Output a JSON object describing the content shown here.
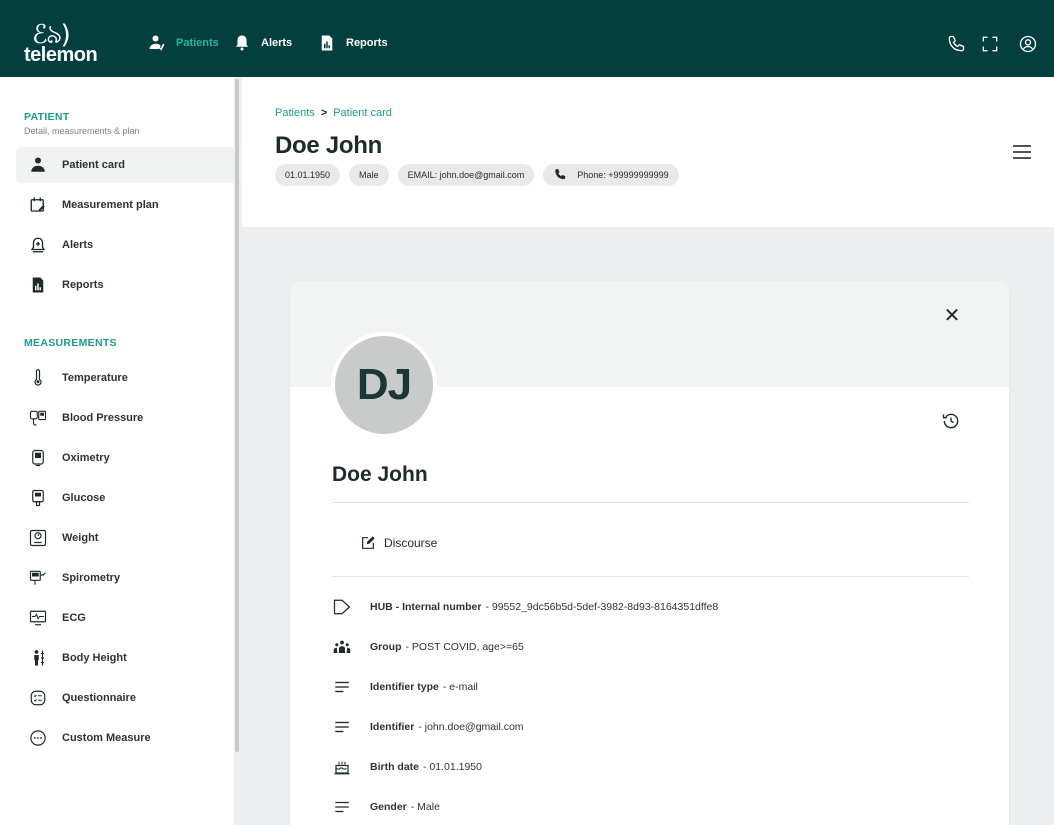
{
  "app": {
    "logo_text": "telemon"
  },
  "topnav": {
    "items": [
      {
        "label": "Patients",
        "icon": "patient-icon",
        "active": true
      },
      {
        "label": "Alerts",
        "icon": "bell-icon"
      },
      {
        "label": "Reports",
        "icon": "report-icon"
      }
    ],
    "right_icons": [
      "phone-icon",
      "fullscreen-icon",
      "account-icon"
    ]
  },
  "sidebar": {
    "patient_section": {
      "title": "PATIENT",
      "subtitle": "Detail, measurements & plan",
      "items": [
        {
          "label": "Patient card",
          "icon": "person-icon",
          "active": true
        },
        {
          "label": "Measurement plan",
          "icon": "calendar-edit-icon"
        },
        {
          "label": "Alerts",
          "icon": "alarm-bell-icon"
        },
        {
          "label": "Reports",
          "icon": "report-icon"
        }
      ]
    },
    "measurements_section": {
      "title": "MEASUREMENTS",
      "items": [
        {
          "label": "Temperature",
          "icon": "thermometer-icon"
        },
        {
          "label": "Blood Pressure",
          "icon": "blood-pressure-icon"
        },
        {
          "label": "Oximetry",
          "icon": "oximeter-icon"
        },
        {
          "label": "Glucose",
          "icon": "glucometer-icon"
        },
        {
          "label": "Weight",
          "icon": "scale-icon"
        },
        {
          "label": "Spirometry",
          "icon": "spirometer-icon"
        },
        {
          "label": "ECG",
          "icon": "ecg-monitor-icon"
        },
        {
          "label": "Body Height",
          "icon": "height-icon"
        },
        {
          "label": "Questionnaire",
          "icon": "questionnaire-icon"
        },
        {
          "label": "Custom Measure",
          "icon": "more-icon"
        }
      ]
    }
  },
  "header": {
    "breadcrumb": {
      "root": "Patients",
      "separator": ">",
      "current": "Patient card"
    },
    "title": "Doe John",
    "chips": {
      "birth": "01.01.1950",
      "gender": "Male",
      "email": "EMAIL: john.doe@gmail.com",
      "phone": "Phone: +99999999999"
    }
  },
  "card": {
    "initials": "DJ",
    "name": "Doe John",
    "discourse_label": "Discourse",
    "rows": [
      {
        "icon": "tag-icon",
        "label": "HUB - Internal number",
        "value": " -  99552_9dc56b5d-5def-3982-8d93-8164351dffe8"
      },
      {
        "icon": "group-icon",
        "label": "Group",
        "value": " - POST COVID, age>=65"
      },
      {
        "icon": "lines-icon",
        "label": "Identifier type",
        "value": " - e-mail"
      },
      {
        "icon": "lines-icon",
        "label": "Identifier",
        "value": " - john.doe@gmail.com"
      },
      {
        "icon": "cake-icon",
        "label": "Birth date",
        "value": " - 01.01.1950"
      },
      {
        "icon": "lines-icon",
        "label": "Gender",
        "value": " - Male"
      }
    ]
  },
  "colors": {
    "topbar": "#043f3f",
    "accent": "#1c9c8c",
    "avatar": "#c9cbca"
  }
}
